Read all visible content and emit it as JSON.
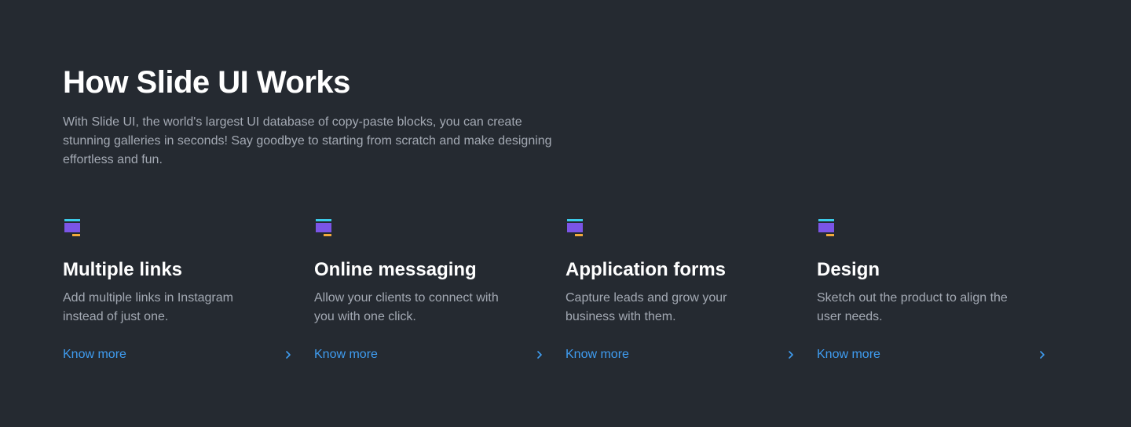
{
  "section": {
    "title": "How Slide UI Works",
    "description": "With Slide UI, the world's largest UI database of copy-paste blocks, you can create stunning galleries in seconds! Say goodbye to starting from scratch and make designing effortless and fun."
  },
  "colors": {
    "background": "#252a31",
    "accent": "#3f9cf0",
    "icon_top": "#3cc9e8",
    "icon_body": "#7b55e6",
    "icon_bottom": "#f2a93b"
  },
  "features": [
    {
      "icon": "block-stack-icon",
      "title": "Multiple links",
      "description": "Add multiple links in Instagram instead of just one.",
      "link_label": "Know more"
    },
    {
      "icon": "block-stack-icon",
      "title": "Online messaging",
      "description": "Allow your clients to connect with you with one click.",
      "link_label": "Know more"
    },
    {
      "icon": "block-stack-icon",
      "title": "Application forms",
      "description": "Capture leads and grow your business with them.",
      "link_label": "Know more"
    },
    {
      "icon": "block-stack-icon",
      "title": "Design",
      "description": "Sketch out the product to align the user needs.",
      "link_label": "Know more"
    }
  ]
}
